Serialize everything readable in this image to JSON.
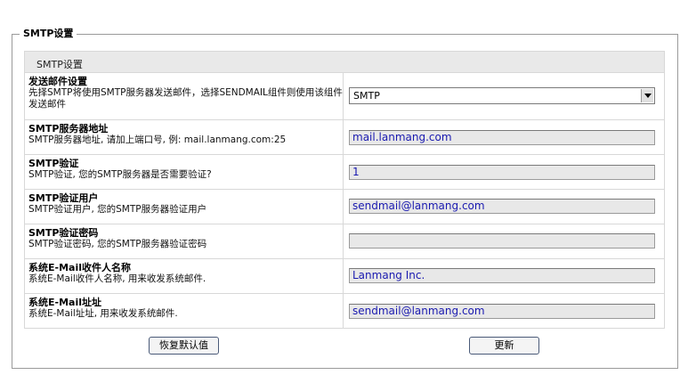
{
  "group": {
    "legend": "SMTP设置"
  },
  "panel": {
    "header": "SMTP设置"
  },
  "rows": [
    {
      "title": "发送邮件设置",
      "desc": "先择SMTP将使用SMTP服务器发送邮件，选择SENDMAIL组件则使用该组件发送邮件",
      "value": "SMTP"
    },
    {
      "title": "SMTP服务器地址",
      "desc": "SMTP服务器地址, 请加上端口号, 例: mail.lanmang.com:25",
      "value": "mail.lanmang.com"
    },
    {
      "title": "SMTP验证",
      "desc": "SMTP验证, 您的SMTP服务器是否需要验证?",
      "value": "1"
    },
    {
      "title": "SMTP验证用户",
      "desc": "SMTP验证用户, 您的SMTP服务器验证用户",
      "value": "sendmail@lanmang.com"
    },
    {
      "title": "SMTP验证密码",
      "desc": "SMTP验证密码, 您的SMTP服务器验证密码",
      "value": ""
    },
    {
      "title": "系统E-Mail收件人名称",
      "desc": "系统E-Mail收件人名称, 用来收发系统邮件.",
      "value": "Lanmang Inc."
    },
    {
      "title": "系统E-Mail址址",
      "desc": "系统E-Mail址址, 用来收发系统邮件.",
      "value": "sendmail@lanmang.com"
    }
  ],
  "buttons": {
    "reset": "恢复默认值",
    "update": "更新"
  }
}
